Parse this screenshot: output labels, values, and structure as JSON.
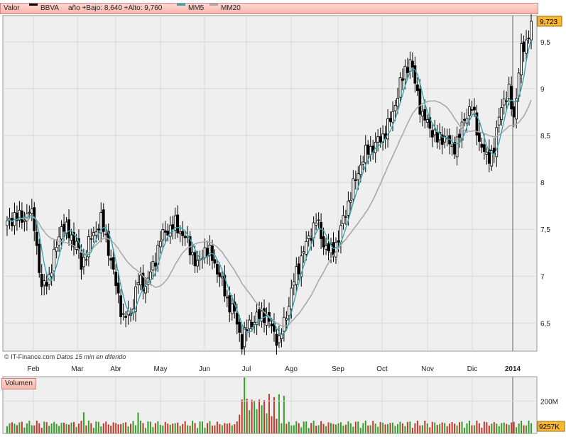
{
  "header": {
    "valor_label": "Valor",
    "ticker": "BBVA",
    "range_text": "año +Bajo: 8,640 +Alto: 9,760",
    "ma5_label": "MM5",
    "ma20_label": "MM20"
  },
  "credit": {
    "source": "© IT-Finance.com",
    "note": "Datos 15 min en diferido"
  },
  "volume_label": "Volumen",
  "colors": {
    "up": "#3a9c2a",
    "down": "#c0392b",
    "ma5": "#3aa6b0",
    "ma20": "#a9a9a9",
    "candle": "#000000",
    "last_price_bg": "#f7b733",
    "grid": "#d8d8d8",
    "plot_bg": "#efefef"
  },
  "chart_data": [
    {
      "type": "line",
      "title": "",
      "series_name": "BBVA",
      "x_ticks": [
        "Feb",
        "Mar",
        "Abr",
        "May",
        "Jun",
        "Jul",
        "Ago",
        "Sep",
        "Oct",
        "Nov",
        "Dic",
        "2014"
      ],
      "ylim": [
        6.2,
        9.78
      ],
      "y_ticks": [
        "6,5",
        "7",
        "7,5",
        "8",
        "8,5",
        "9",
        "9,5"
      ],
      "last_price": "9,723",
      "ma_series": [
        "MM5",
        "MM20"
      ],
      "close_profile": [
        [
          0,
          7.55
        ],
        [
          3,
          7.65
        ],
        [
          6,
          7.6
        ],
        [
          9,
          7.7
        ],
        [
          11,
          7.55
        ],
        [
          14,
          6.85
        ],
        [
          17,
          7.0
        ],
        [
          19,
          7.2
        ],
        [
          22,
          7.55
        ],
        [
          25,
          7.45
        ],
        [
          28,
          7.35
        ],
        [
          30,
          7.1
        ],
        [
          33,
          7.35
        ],
        [
          36,
          7.5
        ],
        [
          38,
          7.6
        ],
        [
          41,
          7.3
        ],
        [
          44,
          6.9
        ],
        [
          47,
          6.55
        ],
        [
          50,
          6.6
        ],
        [
          53,
          6.95
        ],
        [
          56,
          6.9
        ],
        [
          59,
          7.1
        ],
        [
          62,
          7.4
        ],
        [
          65,
          7.5
        ],
        [
          68,
          7.55
        ],
        [
          71,
          7.45
        ],
        [
          74,
          7.3
        ],
        [
          77,
          7.1
        ],
        [
          80,
          7.3
        ],
        [
          83,
          7.2
        ],
        [
          86,
          7.0
        ],
        [
          89,
          6.75
        ],
        [
          92,
          6.6
        ],
        [
          95,
          6.3
        ],
        [
          98,
          6.5
        ],
        [
          101,
          6.55
        ],
        [
          104,
          6.6
        ],
        [
          107,
          6.45
        ],
        [
          110,
          6.3
        ],
        [
          113,
          6.6
        ],
        [
          116,
          6.95
        ],
        [
          119,
          7.2
        ],
        [
          122,
          7.4
        ],
        [
          125,
          7.6
        ],
        [
          128,
          7.35
        ],
        [
          131,
          7.25
        ],
        [
          134,
          7.4
        ],
        [
          137,
          7.7
        ],
        [
          140,
          7.95
        ],
        [
          143,
          8.2
        ],
        [
          146,
          8.35
        ],
        [
          149,
          8.4
        ],
        [
          152,
          8.5
        ],
        [
          155,
          8.65
        ],
        [
          158,
          8.95
        ],
        [
          161,
          9.2
        ],
        [
          163,
          9.3
        ],
        [
          166,
          8.95
        ],
        [
          168,
          8.7
        ],
        [
          171,
          8.6
        ],
        [
          174,
          8.45
        ],
        [
          177,
          8.5
        ],
        [
          180,
          8.35
        ],
        [
          183,
          8.5
        ],
        [
          186,
          8.75
        ],
        [
          188,
          8.8
        ],
        [
          191,
          8.45
        ],
        [
          194,
          8.25
        ],
        [
          197,
          8.35
        ],
        [
          200,
          8.85
        ],
        [
          203,
          8.95
        ],
        [
          205,
          8.7
        ],
        [
          208,
          9.4
        ],
        [
          210,
          9.5
        ],
        [
          212,
          9.72
        ]
      ],
      "volume_notes": {
        "y_tick": "200M",
        "last_volume": "9257K",
        "ylim_max": 350
      }
    }
  ]
}
